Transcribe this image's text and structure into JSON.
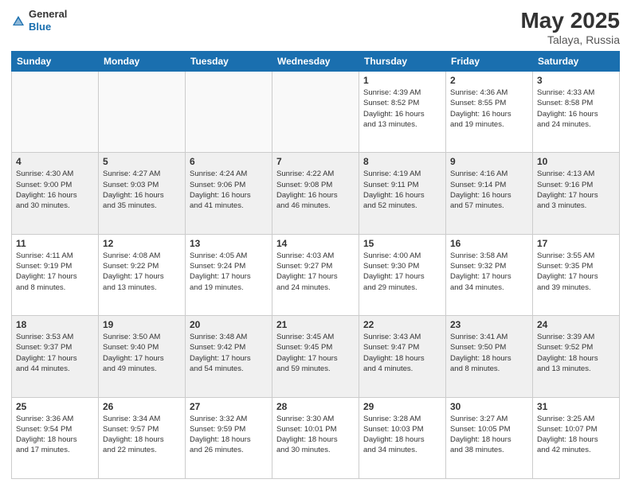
{
  "header": {
    "logo_general": "General",
    "logo_blue": "Blue",
    "title": "May 2025",
    "location": "Talaya, Russia"
  },
  "weekdays": [
    "Sunday",
    "Monday",
    "Tuesday",
    "Wednesday",
    "Thursday",
    "Friday",
    "Saturday"
  ],
  "weeks": [
    [
      {
        "day": "",
        "info": ""
      },
      {
        "day": "",
        "info": ""
      },
      {
        "day": "",
        "info": ""
      },
      {
        "day": "",
        "info": ""
      },
      {
        "day": "1",
        "info": "Sunrise: 4:39 AM\nSunset: 8:52 PM\nDaylight: 16 hours\nand 13 minutes."
      },
      {
        "day": "2",
        "info": "Sunrise: 4:36 AM\nSunset: 8:55 PM\nDaylight: 16 hours\nand 19 minutes."
      },
      {
        "day": "3",
        "info": "Sunrise: 4:33 AM\nSunset: 8:58 PM\nDaylight: 16 hours\nand 24 minutes."
      }
    ],
    [
      {
        "day": "4",
        "info": "Sunrise: 4:30 AM\nSunset: 9:00 PM\nDaylight: 16 hours\nand 30 minutes."
      },
      {
        "day": "5",
        "info": "Sunrise: 4:27 AM\nSunset: 9:03 PM\nDaylight: 16 hours\nand 35 minutes."
      },
      {
        "day": "6",
        "info": "Sunrise: 4:24 AM\nSunset: 9:06 PM\nDaylight: 16 hours\nand 41 minutes."
      },
      {
        "day": "7",
        "info": "Sunrise: 4:22 AM\nSunset: 9:08 PM\nDaylight: 16 hours\nand 46 minutes."
      },
      {
        "day": "8",
        "info": "Sunrise: 4:19 AM\nSunset: 9:11 PM\nDaylight: 16 hours\nand 52 minutes."
      },
      {
        "day": "9",
        "info": "Sunrise: 4:16 AM\nSunset: 9:14 PM\nDaylight: 16 hours\nand 57 minutes."
      },
      {
        "day": "10",
        "info": "Sunrise: 4:13 AM\nSunset: 9:16 PM\nDaylight: 17 hours\nand 3 minutes."
      }
    ],
    [
      {
        "day": "11",
        "info": "Sunrise: 4:11 AM\nSunset: 9:19 PM\nDaylight: 17 hours\nand 8 minutes."
      },
      {
        "day": "12",
        "info": "Sunrise: 4:08 AM\nSunset: 9:22 PM\nDaylight: 17 hours\nand 13 minutes."
      },
      {
        "day": "13",
        "info": "Sunrise: 4:05 AM\nSunset: 9:24 PM\nDaylight: 17 hours\nand 19 minutes."
      },
      {
        "day": "14",
        "info": "Sunrise: 4:03 AM\nSunset: 9:27 PM\nDaylight: 17 hours\nand 24 minutes."
      },
      {
        "day": "15",
        "info": "Sunrise: 4:00 AM\nSunset: 9:30 PM\nDaylight: 17 hours\nand 29 minutes."
      },
      {
        "day": "16",
        "info": "Sunrise: 3:58 AM\nSunset: 9:32 PM\nDaylight: 17 hours\nand 34 minutes."
      },
      {
        "day": "17",
        "info": "Sunrise: 3:55 AM\nSunset: 9:35 PM\nDaylight: 17 hours\nand 39 minutes."
      }
    ],
    [
      {
        "day": "18",
        "info": "Sunrise: 3:53 AM\nSunset: 9:37 PM\nDaylight: 17 hours\nand 44 minutes."
      },
      {
        "day": "19",
        "info": "Sunrise: 3:50 AM\nSunset: 9:40 PM\nDaylight: 17 hours\nand 49 minutes."
      },
      {
        "day": "20",
        "info": "Sunrise: 3:48 AM\nSunset: 9:42 PM\nDaylight: 17 hours\nand 54 minutes."
      },
      {
        "day": "21",
        "info": "Sunrise: 3:45 AM\nSunset: 9:45 PM\nDaylight: 17 hours\nand 59 minutes."
      },
      {
        "day": "22",
        "info": "Sunrise: 3:43 AM\nSunset: 9:47 PM\nDaylight: 18 hours\nand 4 minutes."
      },
      {
        "day": "23",
        "info": "Sunrise: 3:41 AM\nSunset: 9:50 PM\nDaylight: 18 hours\nand 8 minutes."
      },
      {
        "day": "24",
        "info": "Sunrise: 3:39 AM\nSunset: 9:52 PM\nDaylight: 18 hours\nand 13 minutes."
      }
    ],
    [
      {
        "day": "25",
        "info": "Sunrise: 3:36 AM\nSunset: 9:54 PM\nDaylight: 18 hours\nand 17 minutes."
      },
      {
        "day": "26",
        "info": "Sunrise: 3:34 AM\nSunset: 9:57 PM\nDaylight: 18 hours\nand 22 minutes."
      },
      {
        "day": "27",
        "info": "Sunrise: 3:32 AM\nSunset: 9:59 PM\nDaylight: 18 hours\nand 26 minutes."
      },
      {
        "day": "28",
        "info": "Sunrise: 3:30 AM\nSunset: 10:01 PM\nDaylight: 18 hours\nand 30 minutes."
      },
      {
        "day": "29",
        "info": "Sunrise: 3:28 AM\nSunset: 10:03 PM\nDaylight: 18 hours\nand 34 minutes."
      },
      {
        "day": "30",
        "info": "Sunrise: 3:27 AM\nSunset: 10:05 PM\nDaylight: 18 hours\nand 38 minutes."
      },
      {
        "day": "31",
        "info": "Sunrise: 3:25 AM\nSunset: 10:07 PM\nDaylight: 18 hours\nand 42 minutes."
      }
    ]
  ]
}
